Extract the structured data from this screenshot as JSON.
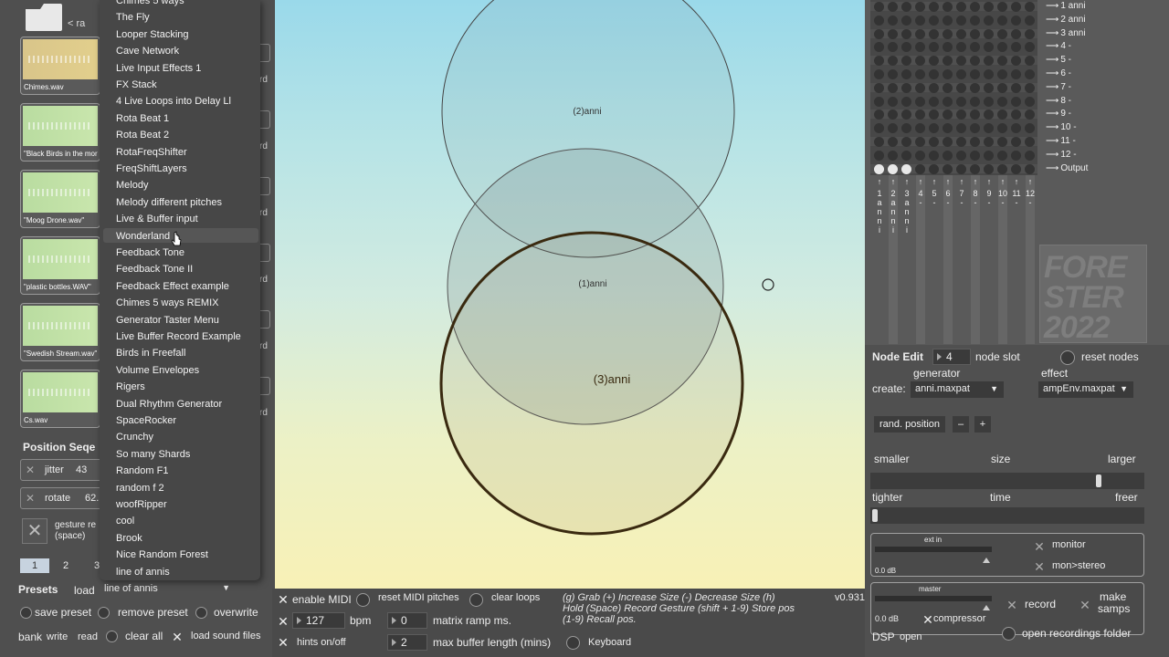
{
  "samples": [
    {
      "name": "Chimes.wav",
      "color": "gold"
    },
    {
      "name": "\"Black Birds in the mor",
      "color": "green"
    },
    {
      "name": "\"Moog Drone.wav\"",
      "color": "green"
    },
    {
      "name": "\"plastic bottles.WAV\"",
      "color": "green"
    },
    {
      "name": "\"Swedish Stream.wav\"",
      "color": "green"
    },
    {
      "name": "Cs.wav",
      "color": "green"
    }
  ],
  "sample_header_partial": "< ra",
  "strip_label": "rd",
  "position_sequencer": {
    "title": "Position Seqe",
    "jitter_label": "jitter",
    "jitter_value": "43",
    "rotate_label": "rotate",
    "rotate_value": "62.",
    "gesture_line1": "gesture re",
    "gesture_line2": "(space)",
    "pages": [
      "1",
      "2",
      "3"
    ]
  },
  "presets": {
    "title": "Presets",
    "load_label": "load",
    "selected": "line of annis",
    "save_preset": "save preset",
    "remove_preset": "remove preset",
    "overwrite": "overwrite",
    "bank": "bank",
    "write": "write",
    "read": "read",
    "clear_all": "clear all",
    "load_sound_files": "load sound files"
  },
  "dropdown": {
    "items": [
      "Chimes 5 ways",
      "The Fly",
      "Looper Stacking",
      "Cave Network",
      "Live Input Effects 1",
      "FX Stack",
      "4 Live Loops into Delay Ll",
      "Rota Beat 1",
      "Rota Beat 2",
      "RotaFreqShifter",
      "FreqShiftLayers",
      "Melody",
      "Melody different pitches",
      "Live & Buffer input",
      "Wonderland",
      "Feedback Tone",
      "Feedback Tone II",
      "Feedback Effect example",
      "Chimes 5 ways REMIX",
      "Generator Taster Menu",
      "Live Buffer Record Example",
      "Birds in Freefall",
      "Volume Envelopes",
      "Rigers",
      "Dual Rhythm Generator",
      "SpaceRocker",
      "Crunchy",
      "So many Shards",
      "Random F1",
      "random f 2",
      "woofRipper",
      "cool",
      "Brook",
      "Nice Random Forest",
      "line of annis"
    ],
    "hovered": "Wonderland"
  },
  "canvas": {
    "nodes": [
      {
        "label": "(2)anni"
      },
      {
        "label": "(1)anni"
      },
      {
        "label": "(3)anni"
      }
    ]
  },
  "bottom_bar": {
    "enable_midi": "enable MIDI",
    "reset_midi": "reset MIDI pitches",
    "clear_loops": "clear loops",
    "bpm_value": "127",
    "bpm_label": "bpm",
    "ramp_value": "0",
    "ramp_label": "matrix ramp ms.",
    "hints": "hints on/off",
    "buffer_value": "2",
    "buffer_label": "max buffer length (mins)",
    "keyboard": "Keyboard",
    "help_line1": "(g) Grab   (+) Increase Size  (-) Decrease Size  (h)",
    "help_line2": "Hold  (Space) Record Gesture  (shift + 1-9) Store pos",
    "help_line3": "(1-9) Recall pos.",
    "version": "v0.931"
  },
  "matrix": {
    "outputs": [
      "1 anni",
      "2 anni",
      "3 anni",
      "4 -",
      "5 -",
      "6 -",
      "7 -",
      "8 -",
      "9 -",
      "10 -",
      "11 -",
      "12 -",
      "Output"
    ],
    "columns": [
      {
        "num": "1",
        "name": [
          "a",
          "n",
          "n",
          "i"
        ]
      },
      {
        "num": "2",
        "name": [
          "a",
          "n",
          "n",
          "i"
        ]
      },
      {
        "num": "3",
        "name": [
          "a",
          "n",
          "n",
          "i"
        ]
      },
      {
        "num": "4",
        "name": [
          "-"
        ]
      },
      {
        "num": "5",
        "name": [
          "-"
        ]
      },
      {
        "num": "6",
        "name": [
          "-"
        ]
      },
      {
        "num": "7",
        "name": [
          "-"
        ]
      },
      {
        "num": "8",
        "name": [
          "-"
        ]
      },
      {
        "num": "9",
        "name": [
          "-"
        ]
      },
      {
        "num": "10",
        "name": [
          "-"
        ]
      },
      {
        "num": "11",
        "name": [
          "-"
        ]
      },
      {
        "num": "12",
        "name": [
          "-"
        ]
      }
    ],
    "logo_text": "FORE STER 2022"
  },
  "node_edit": {
    "title": "Node Edit",
    "slot_value": "4",
    "slot_label": "node slot",
    "reset_nodes": "reset nodes",
    "generator_label": "generator",
    "effect_label": "effect",
    "create_label": "create:",
    "generator_value": "anni.maxpat",
    "effect_value": "ampEnv.maxpat",
    "rand_position": "rand. position",
    "minus": "–",
    "plus": "+",
    "smaller": "smaller",
    "size": "size",
    "larger": "larger",
    "size_fraction": 0.84,
    "tighter": "tighter",
    "time": "time",
    "freer": "freer",
    "time_fraction": 0.0,
    "ext_in": "ext in",
    "ext_db": "0.0 dB",
    "monitor": "monitor",
    "mon_stereo": "mon>stereo",
    "master": "master",
    "master_db": "0.0 dB",
    "compressor": "compressor",
    "record": "record",
    "make_samps_1": "make",
    "make_samps_2": "samps",
    "dsp": "DSP",
    "open": "open",
    "open_folder": "open recordings folder"
  }
}
